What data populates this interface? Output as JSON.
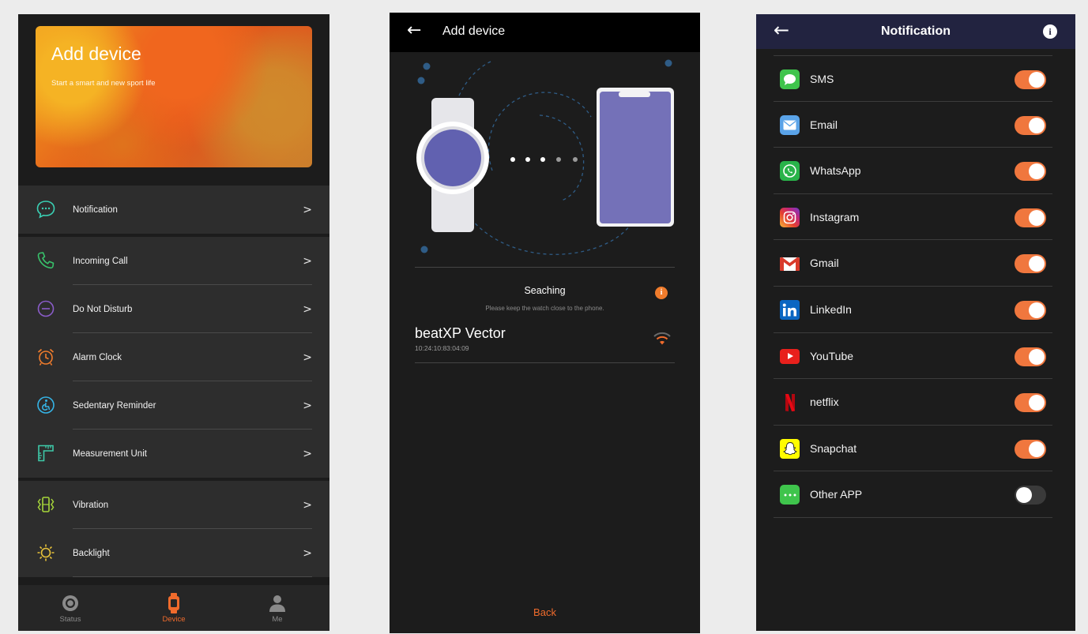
{
  "panel1": {
    "banner": {
      "title": "Add device",
      "subtitle": "Start a smart and new sport life"
    },
    "menu_groups": [
      [
        {
          "label": "Notification",
          "icon": "chat-bubble-icon"
        }
      ],
      [
        {
          "label": "Incoming Call",
          "icon": "phone-icon"
        },
        {
          "label": "Do Not Disturb",
          "icon": "do-not-disturb-icon"
        },
        {
          "label": "Alarm Clock",
          "icon": "alarm-clock-icon"
        },
        {
          "label": "Sedentary Reminder",
          "icon": "sedentary-icon"
        },
        {
          "label": "Measurement Unit",
          "icon": "ruler-icon"
        }
      ],
      [
        {
          "label": "Vibration",
          "icon": "vibration-icon"
        },
        {
          "label": "Backlight",
          "icon": "sun-icon"
        }
      ]
    ],
    "chevron": ">",
    "tabs": [
      {
        "label": "Status",
        "icon": "status-icon",
        "active": false
      },
      {
        "label": "Device",
        "icon": "watch-icon",
        "active": true
      },
      {
        "label": "Me",
        "icon": "person-icon",
        "active": false
      }
    ]
  },
  "panel2": {
    "back_glyph": "←",
    "title": "Add device",
    "status_title": "Seaching",
    "status_hint": "Please keep the watch close to the phone.",
    "info_glyph": "i",
    "device": {
      "name": "beatXP Vector",
      "mac": "10:24:10:83:04:09"
    },
    "back_button": "Back",
    "colors": {
      "accent": "#f06b2c",
      "watch_face": "#6161b0",
      "phone_screen": "#7471b8"
    }
  },
  "panel3": {
    "back_glyph": "←",
    "title": "Notification",
    "info_glyph": "i",
    "apps": [
      {
        "name": "SMS",
        "icon": "sms-icon",
        "enabled": true
      },
      {
        "name": "Email",
        "icon": "email-icon",
        "enabled": true
      },
      {
        "name": "WhatsApp",
        "icon": "whatsapp-icon",
        "enabled": true
      },
      {
        "name": "Instagram",
        "icon": "instagram-icon",
        "enabled": true
      },
      {
        "name": "Gmail",
        "icon": "gmail-icon",
        "enabled": true
      },
      {
        "name": "LinkedIn",
        "icon": "linkedin-icon",
        "enabled": true
      },
      {
        "name": "YouTube",
        "icon": "youtube-icon",
        "enabled": true
      },
      {
        "name": "netflix",
        "icon": "netflix-icon",
        "enabled": true
      },
      {
        "name": "Snapchat",
        "icon": "snapchat-icon",
        "enabled": true
      },
      {
        "name": "Other APP",
        "icon": "other-app-icon",
        "enabled": false
      }
    ],
    "colors": {
      "header": "#222340",
      "toggle_on": "#f0773e"
    }
  }
}
